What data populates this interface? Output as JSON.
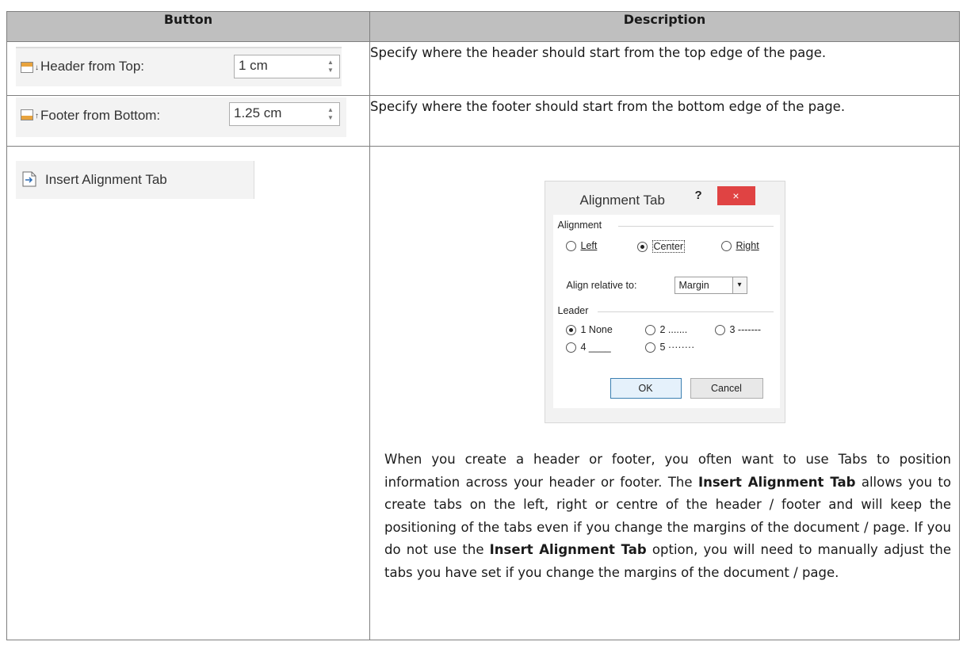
{
  "table": {
    "col_button": "Button",
    "col_description": "Description"
  },
  "rows": [
    {
      "control_label": "Header from Top:",
      "control_value": "1 cm",
      "description": "Specify where the header should start from the top edge of the page."
    },
    {
      "control_label": "Footer from Bottom:",
      "control_value": "1.25 cm",
      "description": "Specify where the footer should start from the bottom edge of the page."
    },
    {
      "control_label": "Insert Alignment Tab"
    }
  ],
  "dialog": {
    "title": "Alignment Tab",
    "help": "?",
    "close": "×",
    "alignment_group": "Alignment",
    "align_left": "Left",
    "align_center": "Center",
    "align_right": "Right",
    "relative_label": "Align relative to:",
    "relative_value": "Margin",
    "leader_group": "Leader",
    "leader_1": "1 None",
    "leader_2": "2 .......",
    "leader_3": "3 -------",
    "leader_4": "4 ____",
    "leader_5": "5 ········",
    "ok": "OK",
    "cancel": "Cancel"
  },
  "paragraph": {
    "p1": "When you create a header or footer, you often want to use Tabs to position information across your header or footer. The ",
    "b1": "Insert Alignment Tab",
    "p2": " allows you to create tabs on the left, right or centre of the header / footer and will keep the positioning of the tabs even if you change the margins of the document / page. If you do not use the ",
    "b2": "Insert Alignment Tab",
    "p3": " option, you will need to manually adjust the tabs you have set if you change the margins of the document / page."
  },
  "icons": {
    "header_from_top": "header-from-top-icon",
    "footer_from_bottom": "footer-from-bottom-icon",
    "insert_alignment_tab": "insert-alignment-tab-icon"
  }
}
